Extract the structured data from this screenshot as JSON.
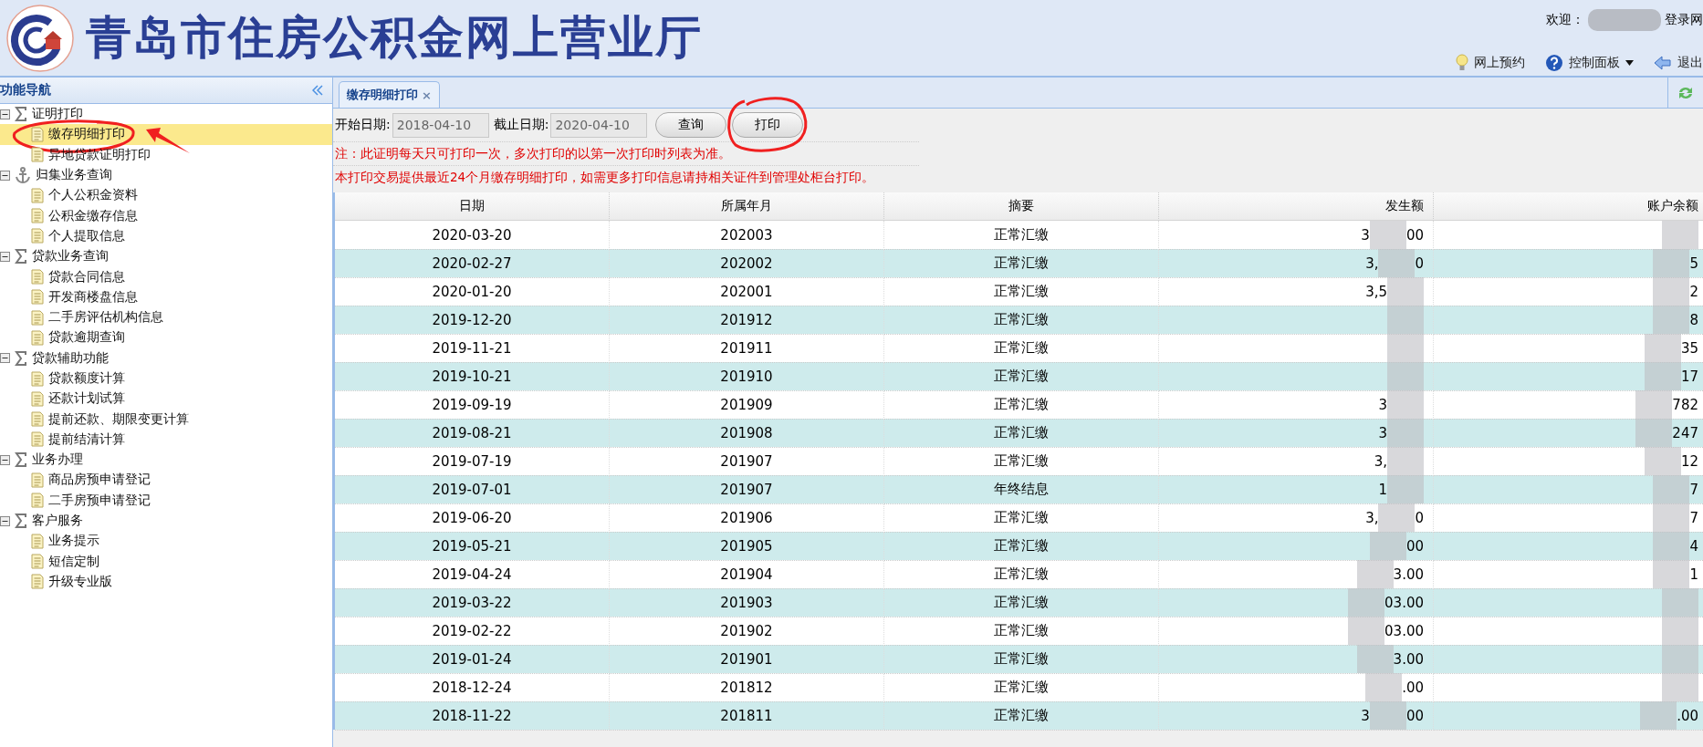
{
  "header": {
    "title": "青岛市住房公积金网上营业厅",
    "welcome": "欢迎：",
    "login_link": "登录网",
    "links": [
      {
        "label": "网上预约",
        "kind": "bulb"
      },
      {
        "label": "控制面板",
        "kind": "help",
        "dropdown": true
      },
      {
        "label": "退出",
        "kind": "exit"
      }
    ]
  },
  "sidebar": {
    "title": "功能导航",
    "groups": [
      {
        "label": "证明打印",
        "kind": "sigma",
        "expanded": true,
        "children": [
          {
            "label": "缴存明细打印",
            "selected": true,
            "circled": true
          },
          {
            "label": "异地贷款证明打印",
            "selected": false,
            "circled": false
          }
        ]
      },
      {
        "label": "归集业务查询",
        "kind": "anchor",
        "expanded": true,
        "children": [
          {
            "label": "个人公积金资料",
            "selected": false,
            "circled": false
          },
          {
            "label": "公积金缴存信息",
            "selected": false,
            "circled": false
          },
          {
            "label": "个人提取信息",
            "selected": false,
            "circled": false
          }
        ]
      },
      {
        "label": "贷款业务查询",
        "kind": "sigma",
        "expanded": true,
        "children": [
          {
            "label": "贷款合同信息",
            "selected": false,
            "circled": false
          },
          {
            "label": "开发商楼盘信息",
            "selected": false,
            "circled": false
          },
          {
            "label": "二手房评估机构信息",
            "selected": false,
            "circled": false
          },
          {
            "label": "贷款逾期查询",
            "selected": false,
            "circled": false
          }
        ]
      },
      {
        "label": "贷款辅助功能",
        "kind": "sigma",
        "expanded": true,
        "children": [
          {
            "label": "贷款额度计算",
            "selected": false,
            "circled": false
          },
          {
            "label": "还款计划试算",
            "selected": false,
            "circled": false
          },
          {
            "label": "提前还款、期限变更计算",
            "selected": false,
            "circled": false
          },
          {
            "label": "提前结清计算",
            "selected": false,
            "circled": false
          }
        ]
      },
      {
        "label": "业务办理",
        "kind": "sigma",
        "expanded": true,
        "children": [
          {
            "label": "商品房预申请登记",
            "selected": false,
            "circled": false
          },
          {
            "label": "二手房预申请登记",
            "selected": false,
            "circled": false
          }
        ]
      },
      {
        "label": "客户服务",
        "kind": "sigma",
        "expanded": true,
        "children": [
          {
            "label": "业务提示",
            "selected": false,
            "circled": false
          },
          {
            "label": "短信定制",
            "selected": false,
            "circled": false
          },
          {
            "label": "升级专业版",
            "selected": false,
            "circled": false
          }
        ]
      }
    ]
  },
  "tabs": [
    {
      "label": "缴存明细打印",
      "close": "×",
      "selected": true
    }
  ],
  "filters": {
    "start_label": "开始日期:",
    "start_value": "2018-04-10",
    "end_label": "截止日期:",
    "end_value": "2020-04-10"
  },
  "buttons": [
    {
      "label": "查询",
      "circled": false
    },
    {
      "label": "打印",
      "circled": true
    }
  ],
  "notes": [
    "注：此证明每天只可打印一次，多次打印的以第一次打印时列表为准。",
    "本打印交易提供最近24个月缴存明细打印，如需更多打印信息请持相关证件到管理处柜台打印。"
  ],
  "table": {
    "columns": [
      "日期",
      "所属年月",
      "摘要",
      "发生额",
      "账户余额"
    ],
    "rows": [
      {
        "date": "2020-03-20",
        "month": "202003",
        "summary": "正常汇缴",
        "amount": {
          "before": "3",
          "after": "00"
        },
        "balance": {}
      },
      {
        "date": "2020-02-27",
        "month": "202002",
        "summary": "正常汇缴",
        "amount": {
          "before": "3,",
          "after": "0"
        },
        "balance": {
          "after": "5"
        }
      },
      {
        "date": "2020-01-20",
        "month": "202001",
        "summary": "正常汇缴",
        "amount": {
          "before": "3,5"
        },
        "balance": {
          "after": "2"
        }
      },
      {
        "date": "2019-12-20",
        "month": "201912",
        "summary": "正常汇缴",
        "amount": {},
        "balance": {
          "after": "8"
        }
      },
      {
        "date": "2019-11-21",
        "month": "201911",
        "summary": "正常汇缴",
        "amount": {},
        "balance": {
          "after": "35"
        }
      },
      {
        "date": "2019-10-21",
        "month": "201910",
        "summary": "正常汇缴",
        "amount": {},
        "balance": {
          "after": "17"
        }
      },
      {
        "date": "2019-09-19",
        "month": "201909",
        "summary": "正常汇缴",
        "amount": {
          "before": "3"
        },
        "balance": {
          "after": "782"
        }
      },
      {
        "date": "2019-08-21",
        "month": "201908",
        "summary": "正常汇缴",
        "amount": {
          "before": "3"
        },
        "balance": {
          "after": "247"
        }
      },
      {
        "date": "2019-07-19",
        "month": "201907",
        "summary": "正常汇缴",
        "amount": {
          "before": "3,"
        },
        "balance": {
          "after": "12"
        }
      },
      {
        "date": "2019-07-01",
        "month": "201907",
        "summary": "年终结息",
        "amount": {
          "before": "1"
        },
        "balance": {
          "after": "7"
        }
      },
      {
        "date": "2019-06-20",
        "month": "201906",
        "summary": "正常汇缴",
        "amount": {
          "before": "3,",
          "after": "0"
        },
        "balance": {
          "after": "7"
        }
      },
      {
        "date": "2019-05-21",
        "month": "201905",
        "summary": "正常汇缴",
        "amount": {
          "after": "00"
        },
        "balance": {
          "after": "4"
        }
      },
      {
        "date": "2019-04-24",
        "month": "201904",
        "summary": "正常汇缴",
        "amount": {
          "after": "3.00"
        },
        "balance": {
          "after": "1"
        }
      },
      {
        "date": "2019-03-22",
        "month": "201903",
        "summary": "正常汇缴",
        "amount": {
          "after": "03.00"
        },
        "balance": {}
      },
      {
        "date": "2019-02-22",
        "month": "201902",
        "summary": "正常汇缴",
        "amount": {
          "after": "03.00"
        },
        "balance": {}
      },
      {
        "date": "2019-01-24",
        "month": "201901",
        "summary": "正常汇缴",
        "amount": {
          "after": "3.00"
        },
        "balance": {}
      },
      {
        "date": "2018-12-24",
        "month": "201812",
        "summary": "正常汇缴",
        "amount": {
          "after": ".00"
        },
        "balance": {}
      },
      {
        "date": "2018-11-22",
        "month": "201811",
        "summary": "正常汇缴",
        "amount": {
          "before": "3",
          "after": "00"
        },
        "balance": {
          "after": ".00"
        }
      }
    ]
  }
}
